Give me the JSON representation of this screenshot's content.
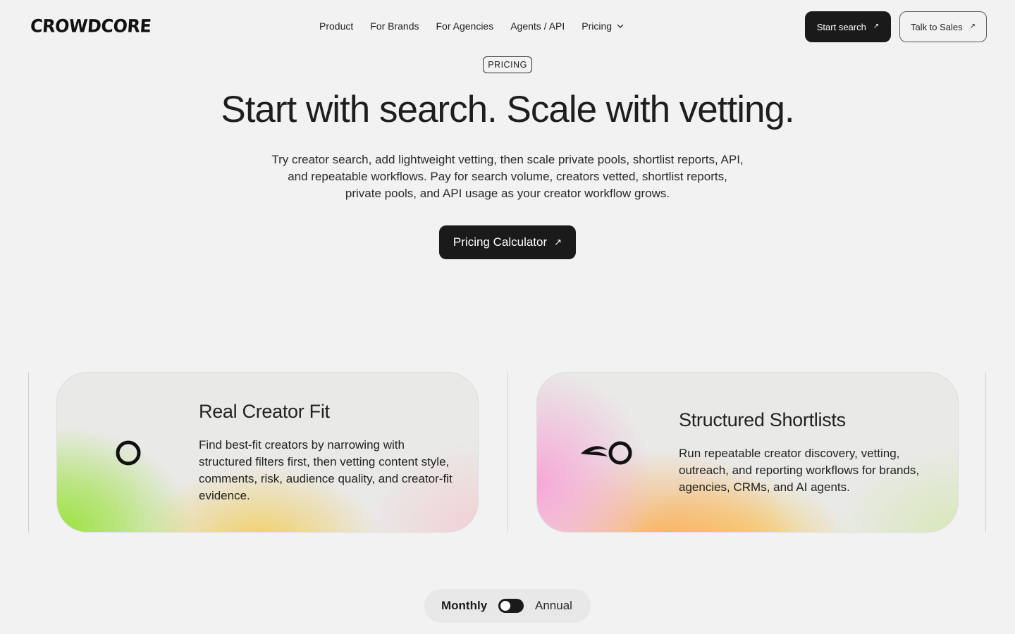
{
  "brand": {
    "logo_text": "CROWDCORE"
  },
  "nav": {
    "items": [
      {
        "label": "Product"
      },
      {
        "label": "For Brands"
      },
      {
        "label": "For Agencies"
      },
      {
        "label": "Agents / API"
      },
      {
        "label": "Pricing",
        "icon": "chevron-down-icon"
      }
    ]
  },
  "header_actions": {
    "start_search": {
      "label": "Start search",
      "icon": "arrow-up-right-icon"
    },
    "talk_to_sales": {
      "label": "Talk to Sales",
      "icon": "arrow-up-right-icon"
    }
  },
  "hero": {
    "badge": "PRICING",
    "title": "Start with search. Scale with vetting.",
    "subtitle_lines": [
      "Try creator search, add lightweight vetting, then scale private pools, shortlist reports, API,",
      "and repeatable workflows. Pay for search volume, creators vetted, shortlist reports,",
      "private pools, and API usage as your creator workflow grows."
    ],
    "cta": {
      "label": "Pricing Calculator",
      "icon": "arrow-up-right-icon"
    }
  },
  "cards": [
    {
      "icon": "ring-icon",
      "title": "Real Creator Fit",
      "text": "Find best-fit creators by narrowing with structured filters first, then vetting content style, comments, risk, audience quality, and creator-fit evidence."
    },
    {
      "icon": "comet-ring-icon",
      "title": "Structured Shortlists",
      "text": "Run repeatable creator discovery, vetting, outreach, and reporting workflows for brands, agencies, CRMs, and AI agents."
    }
  ],
  "billing_toggle": {
    "left_label": "Monthly",
    "right_label": "Annual",
    "selected": "Monthly"
  },
  "colors": {
    "background": "#f2f2f2",
    "dark_button": "#1a1a1a",
    "card_green": "#9be23d",
    "card_pink": "#f7a7d6",
    "card_orange": "#fbb05c"
  }
}
